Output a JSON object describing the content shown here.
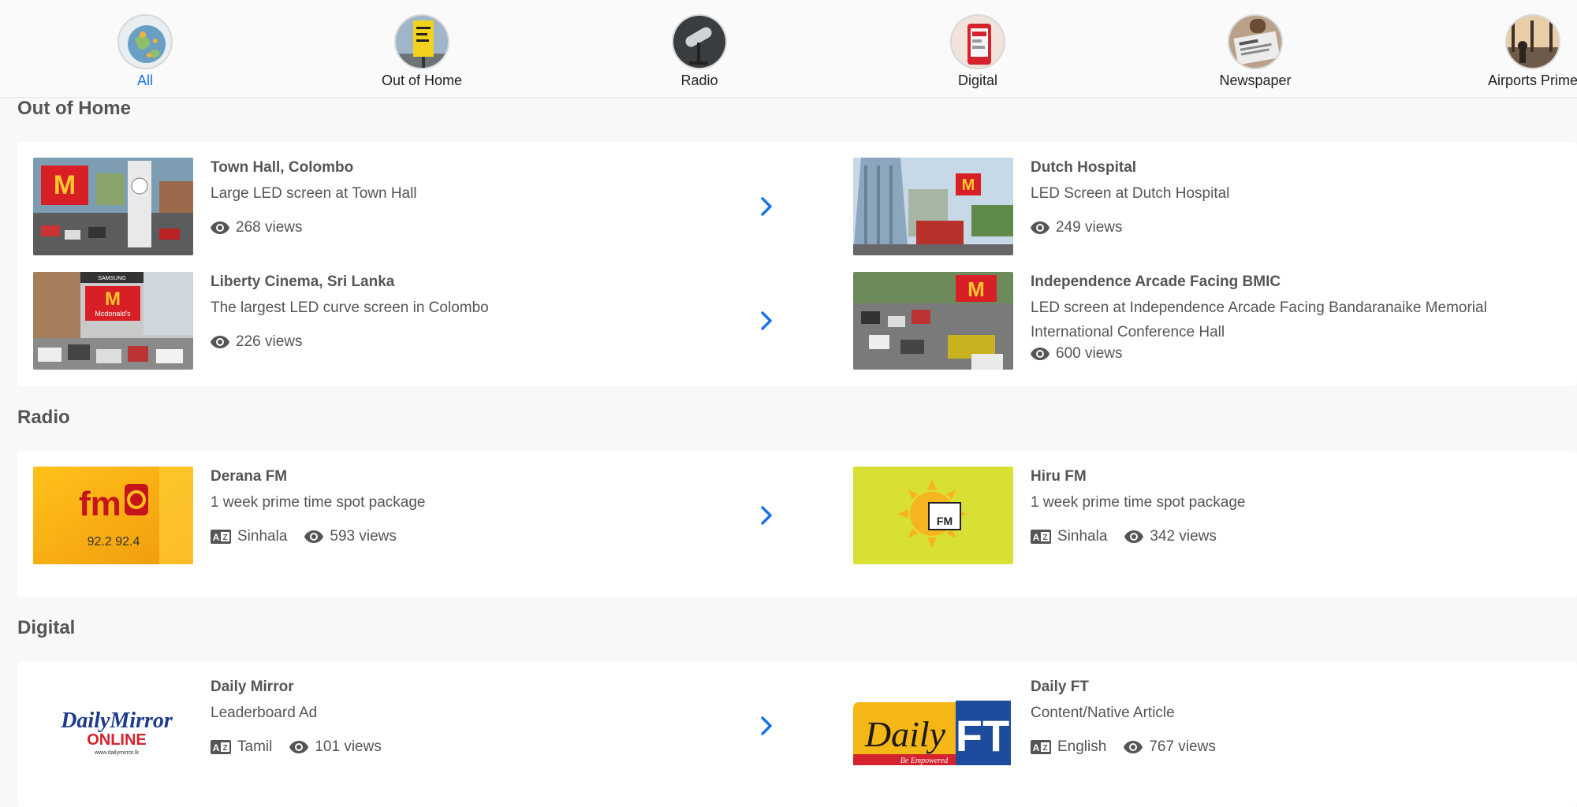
{
  "categories": [
    {
      "label": "All",
      "icon": "globe-icon",
      "active": true
    },
    {
      "label": "Out of Home",
      "icon": "billboard-icon",
      "active": false
    },
    {
      "label": "Radio",
      "icon": "microphone-icon",
      "active": false
    },
    {
      "label": "Digital",
      "icon": "phone-icon",
      "active": false
    },
    {
      "label": "Newspaper",
      "icon": "newspaper-icon",
      "active": false
    },
    {
      "label": "Airports Prime",
      "icon": "airport-icon",
      "active": false
    }
  ],
  "sections": {
    "out_of_home": {
      "title": "Out of Home",
      "items": [
        {
          "title": "Town Hall, Colombo",
          "desc": "Large LED screen at Town Hall",
          "views": "268 views",
          "thumb_brand": "M"
        },
        {
          "title": "Dutch Hospital",
          "desc": "LED Screen at Dutch Hospital",
          "views": "249 views",
          "thumb_brand": "M"
        },
        {
          "title": "Liberty Cinema, Sri Lanka",
          "desc": "The largest LED curve screen in Colombo",
          "views": "226 views",
          "thumb_brand": "M",
          "thumb_text": "Mcdonald's",
          "thumb_top": "SAMSUNG"
        },
        {
          "title": "Independence Arcade Facing BMIC",
          "desc": "LED screen at Independence Arcade Facing Bandaranaike Memorial International Conference Hall",
          "views": "600 views",
          "thumb_brand": "M"
        }
      ]
    },
    "radio": {
      "title": "Radio",
      "items": [
        {
          "title": "Derana FM",
          "desc": "1 week prime time spot package",
          "language": "Sinhala",
          "views": "593 views",
          "thumb_text": "fm",
          "thumb_sub": "92.2 92.4"
        },
        {
          "title": "Hiru FM",
          "desc": "1 week prime time spot package",
          "language": "Sinhala",
          "views": "342 views",
          "thumb_text": "FM"
        }
      ]
    },
    "digital": {
      "title": "Digital",
      "items": [
        {
          "title": "Daily Mirror",
          "desc": "Leaderboard Ad",
          "language": "Tamil",
          "views": "101 views",
          "logo_main": "DailyMirror",
          "logo_sub": "ONLINE",
          "logo_url": "www.dailymirror.lk"
        },
        {
          "title": "Daily FT",
          "desc": "Content/Native Article",
          "language": "English",
          "views": "767 views",
          "logo_main": "Daily",
          "logo_ft": "FT",
          "logo_tag": "Be Empowered"
        }
      ]
    }
  },
  "colors": {
    "accent": "#1a73e8",
    "text": "#555555",
    "card": "#ffffff",
    "background": "#f8f8f8"
  }
}
